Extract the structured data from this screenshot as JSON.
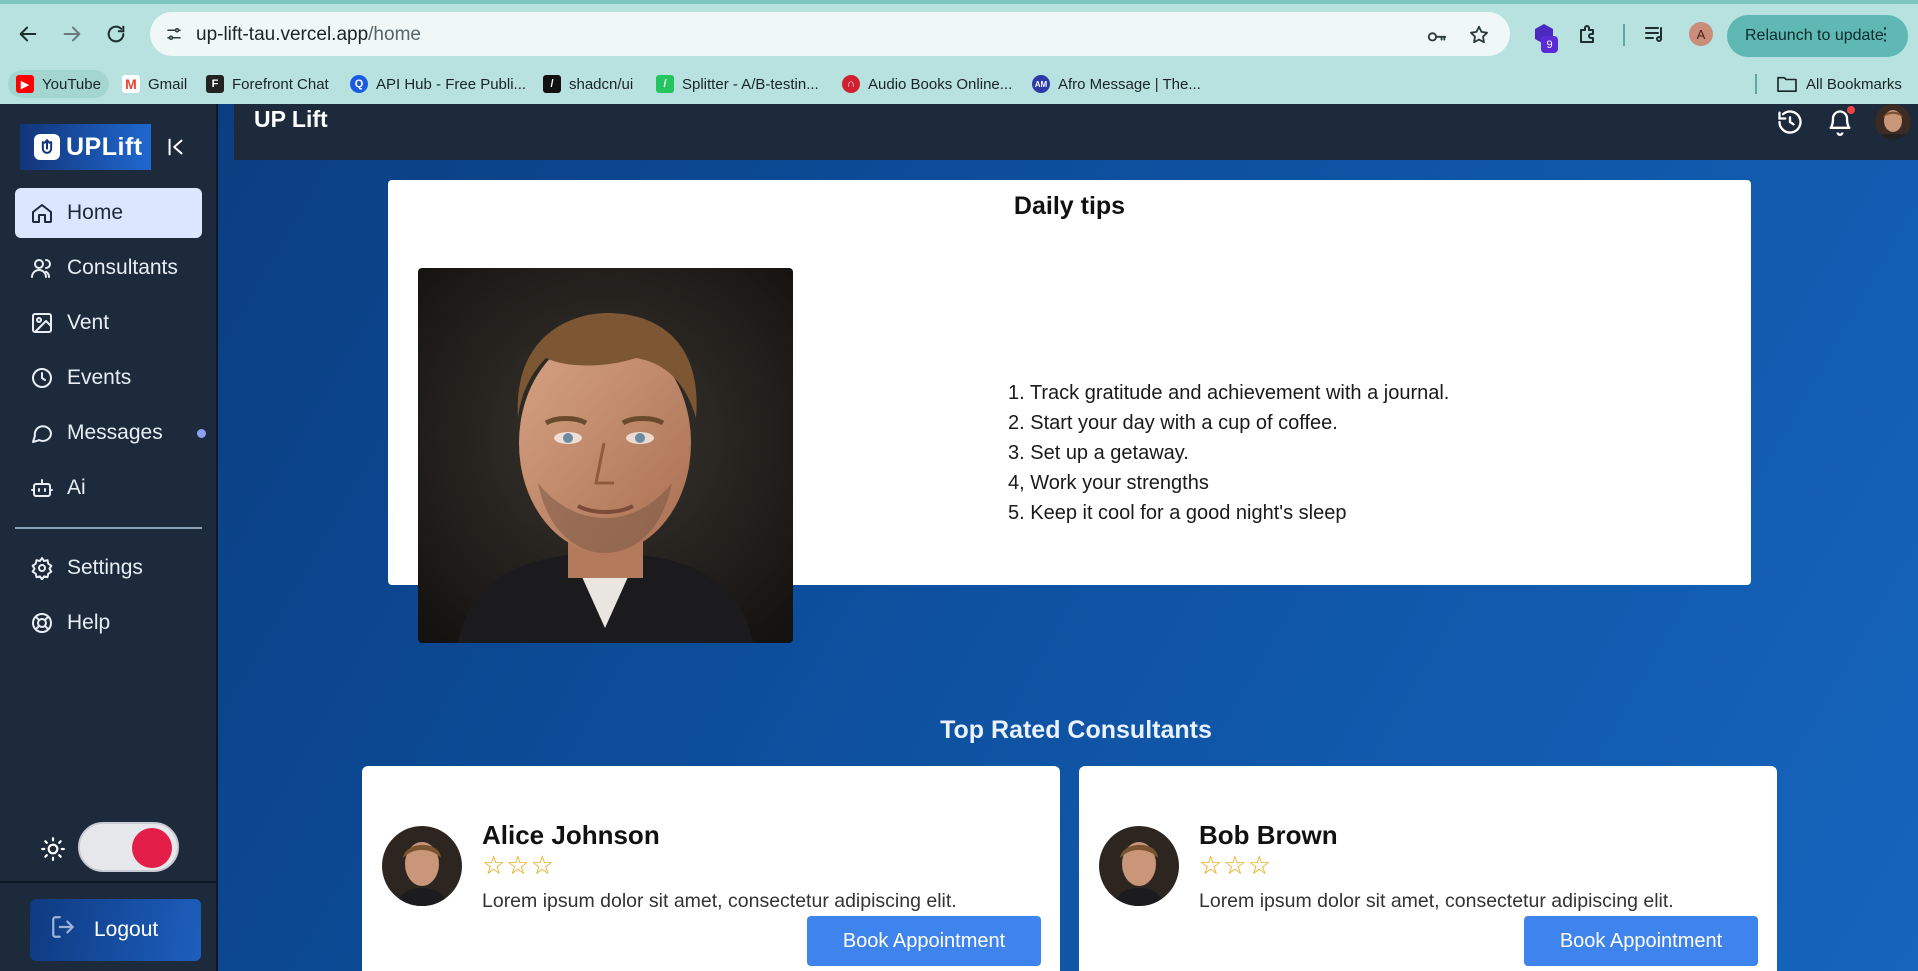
{
  "browser": {
    "url_host": "up-lift-tau.vercel.app",
    "url_path": "/home",
    "extension_badge": "9",
    "profile_initial": "A",
    "relaunch_label": "Relaunch to update",
    "bookmarks": [
      {
        "label": "YouTube",
        "icon": "youtube-favicon",
        "color": "#ff0000"
      },
      {
        "label": "Gmail",
        "icon": "gmail-favicon",
        "color": "#ea4335"
      },
      {
        "label": "Forefront Chat",
        "icon": "forefront-favicon",
        "color": "#222222"
      },
      {
        "label": "API Hub - Free Publi...",
        "icon": "apihub-favicon",
        "color": "#1a5be0"
      },
      {
        "label": "shadcn/ui",
        "icon": "shadcn-favicon",
        "color": "#111111"
      },
      {
        "label": "Splitter - A/B-testin...",
        "icon": "splitter-favicon",
        "color": "#22c55e"
      },
      {
        "label": "Audio Books Online...",
        "icon": "audiobooks-favicon",
        "color": "#d11f2f"
      },
      {
        "label": "Afro Message | The...",
        "icon": "afromessage-favicon",
        "color": "#2b3aa8"
      }
    ],
    "all_bookmarks_label": "All Bookmarks"
  },
  "sidebar": {
    "logo_text": "UPLift",
    "items": [
      {
        "label": "Home",
        "icon": "home-icon",
        "active": true
      },
      {
        "label": "Consultants",
        "icon": "users-icon"
      },
      {
        "label": "Vent",
        "icon": "image-icon"
      },
      {
        "label": "Events",
        "icon": "clock-icon"
      },
      {
        "label": "Messages",
        "icon": "message-icon",
        "has_indicator": true
      },
      {
        "label": "Ai",
        "icon": "bot-icon"
      },
      {
        "label": "Settings",
        "icon": "gear-icon"
      },
      {
        "label": "Help",
        "icon": "lifebuoy-icon"
      }
    ],
    "logout_label": "Logout",
    "theme_toggle_on": true
  },
  "topbar": {
    "title": "UP Lift"
  },
  "daily_tips": {
    "title": "Daily tips",
    "tips": [
      "1. Track gratitude and achievement with a journal.",
      "2. Start your day with a cup of coffee.",
      "3. Set up a getaway.",
      "4, Work your strengths",
      "5. Keep it cool for a good night's sleep"
    ]
  },
  "consultants": {
    "title": "Top Rated Consultants",
    "items": [
      {
        "name": "Alice Johnson",
        "stars": "☆☆☆",
        "rating": 3,
        "bio": "Lorem ipsum dolor sit amet, consectetur adipiscing elit.",
        "cta": "Book Appointment"
      },
      {
        "name": "Bob Brown",
        "stars": "☆☆☆",
        "rating": 3,
        "bio": "Lorem ipsum dolor sit amet, consectetur adipiscing elit.",
        "cta": "Book Appointment"
      }
    ]
  },
  "colors": {
    "sidebar_bg": "#1c2a3b",
    "accent_blue": "#3f84ec",
    "toggle_knob": "#e11d48",
    "star": "#e7a400"
  }
}
